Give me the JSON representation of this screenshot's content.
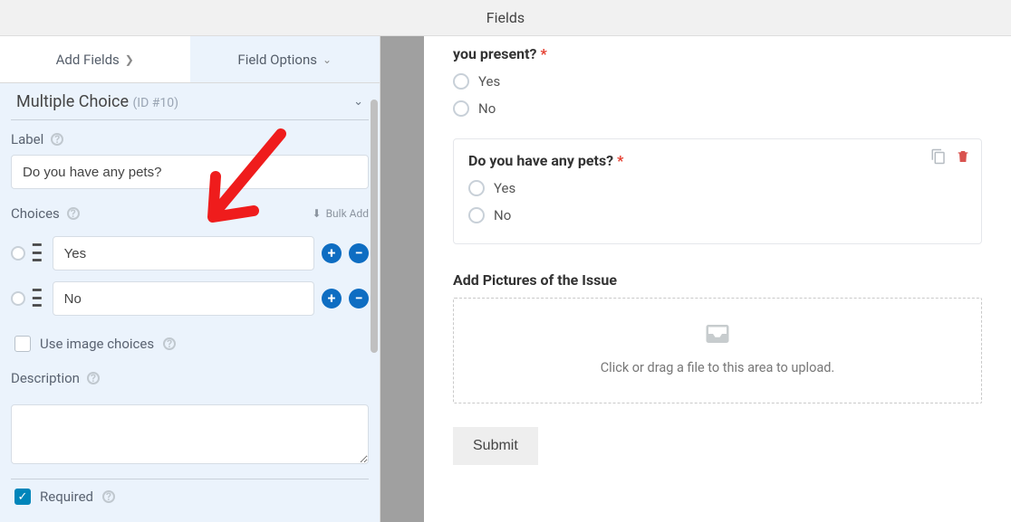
{
  "header": {
    "title": "Fields"
  },
  "tabs": {
    "add_fields": "Add Fields",
    "field_options": "Field Options"
  },
  "field_heading": {
    "name": "Multiple Choice",
    "id": "(ID #10)"
  },
  "sidebar": {
    "label_title": "Label",
    "label_value": "Do you have any pets?",
    "choices_title": "Choices",
    "bulk_add": "Bulk Add",
    "choices": [
      "Yes",
      "No"
    ],
    "use_image_choices": "Use image choices",
    "description_title": "Description",
    "required": "Required"
  },
  "preview": {
    "q1": {
      "label": "you present?",
      "options": [
        "Yes",
        "No"
      ]
    },
    "q2": {
      "label": "Do you have any pets?",
      "options": [
        "Yes",
        "No"
      ]
    },
    "upload_label": "Add Pictures of the Issue",
    "dropzone_text": "Click or drag a file to this area to upload.",
    "submit": "Submit"
  }
}
